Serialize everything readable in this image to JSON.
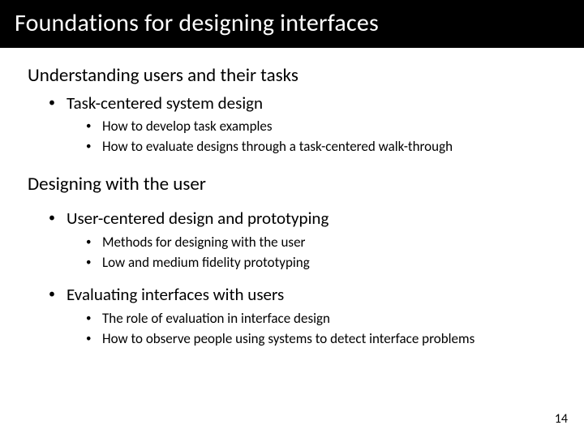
{
  "title": "Foundations for designing interfaces",
  "sections": [
    {
      "heading": "Understanding users and their tasks",
      "items": [
        {
          "label": "Task-centered system design",
          "sub": [
            "How to develop task examples",
            "How to evaluate designs through a task-centered walk-through"
          ]
        }
      ]
    },
    {
      "heading": "Designing with the user",
      "items": [
        {
          "label": "User-centered design and prototyping",
          "sub": [
            "Methods for designing with the user",
            "Low and medium fidelity prototyping"
          ]
        },
        {
          "label": "Evaluating interfaces with users",
          "sub": [
            "The role of evaluation in interface design",
            "How to observe people using systems to detect interface problems"
          ]
        }
      ]
    }
  ],
  "page_number": "14"
}
